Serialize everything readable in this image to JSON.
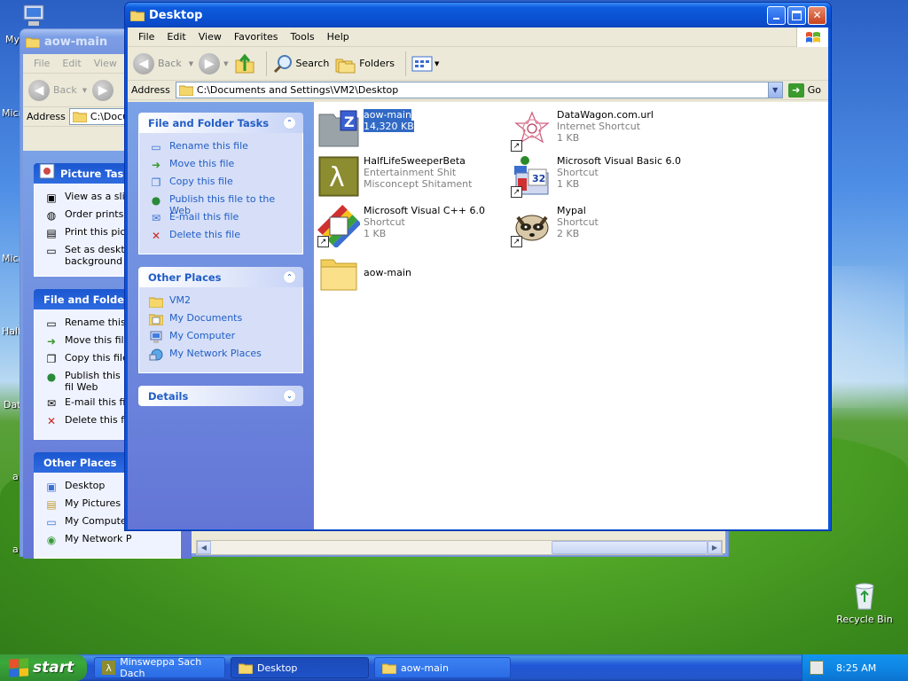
{
  "desktop": {
    "partial_labels": [
      "My",
      "Micro",
      "Micro",
      "Half",
      "Dat",
      "a",
      "a"
    ],
    "recycle_bin": "Recycle Bin"
  },
  "back_window": {
    "title": "aow-main",
    "menu": [
      "File",
      "Edit",
      "View"
    ],
    "back_label": "Back",
    "address_label": "Address",
    "address_value": "C:\\Docu",
    "panels": [
      {
        "title": "Picture Tasks",
        "items": [
          "View as a slide",
          "Order prints o",
          "Print this pictu",
          "Set as deskto background"
        ]
      },
      {
        "title": "File and Folder T",
        "items": [
          "Rename this f",
          "Move this file",
          "Copy this file",
          "Publish this fil Web",
          "E-mail this file",
          "Delete this file"
        ]
      },
      {
        "title": "Other Places",
        "items": [
          "Desktop",
          "My Pictures",
          "My Computer",
          "My Network P"
        ]
      }
    ]
  },
  "window": {
    "title": "Desktop",
    "menu": [
      "File",
      "Edit",
      "View",
      "Favorites",
      "Tools",
      "Help"
    ],
    "toolbar": {
      "back": "Back",
      "search": "Search",
      "folders": "Folders"
    },
    "address_label": "Address",
    "address_value": "C:\\Documents and Settings\\VM2\\Desktop",
    "go_label": "Go",
    "file_tasks": {
      "title": "File and Folder Tasks",
      "items": [
        "Rename this file",
        "Move this file",
        "Copy this file",
        "Publish this file to the Web",
        "E-mail this file",
        "Delete this file"
      ]
    },
    "other_places": {
      "title": "Other Places",
      "items": [
        "VM2",
        "My Documents",
        "My Computer",
        "My Network Places"
      ]
    },
    "details": {
      "title": "Details"
    },
    "files": [
      {
        "name": "aow-main",
        "line2": "14,320 KB",
        "line3": "",
        "icon": "zip-folder-icon",
        "selected": true
      },
      {
        "name": "DataWagon.com.url",
        "line2": "Internet Shortcut",
        "line3": "1 KB",
        "icon": "internet-shortcut-icon"
      },
      {
        "name": "HalfLifeSweeperBeta",
        "line2": "Entertainment Shit",
        "line3": "Misconcept Shitament",
        "icon": "lambda-icon"
      },
      {
        "name": "Microsoft Visual Basic 6.0",
        "line2": "Shortcut",
        "line3": "1 KB",
        "icon": "visual-basic-icon"
      },
      {
        "name": "Microsoft Visual C++ 6.0",
        "line2": "Shortcut",
        "line3": "1 KB",
        "icon": "visual-cpp-icon"
      },
      {
        "name": "Mypal",
        "line2": "Shortcut",
        "line3": "2 KB",
        "icon": "raccoon-icon"
      },
      {
        "name": "aow-main",
        "line2": "",
        "line3": "",
        "icon": "folder-icon"
      }
    ]
  },
  "taskbar": {
    "start": "start",
    "buttons": [
      {
        "label": "Minsweppa Sach Dach",
        "active": false
      },
      {
        "label": "Desktop",
        "active": true
      },
      {
        "label": "aow-main",
        "active": false
      }
    ],
    "clock": "8:25 AM"
  },
  "colors": {
    "xp_blue": "#0a53d8",
    "link_blue": "#215dc6",
    "selection": "#316ac5"
  }
}
